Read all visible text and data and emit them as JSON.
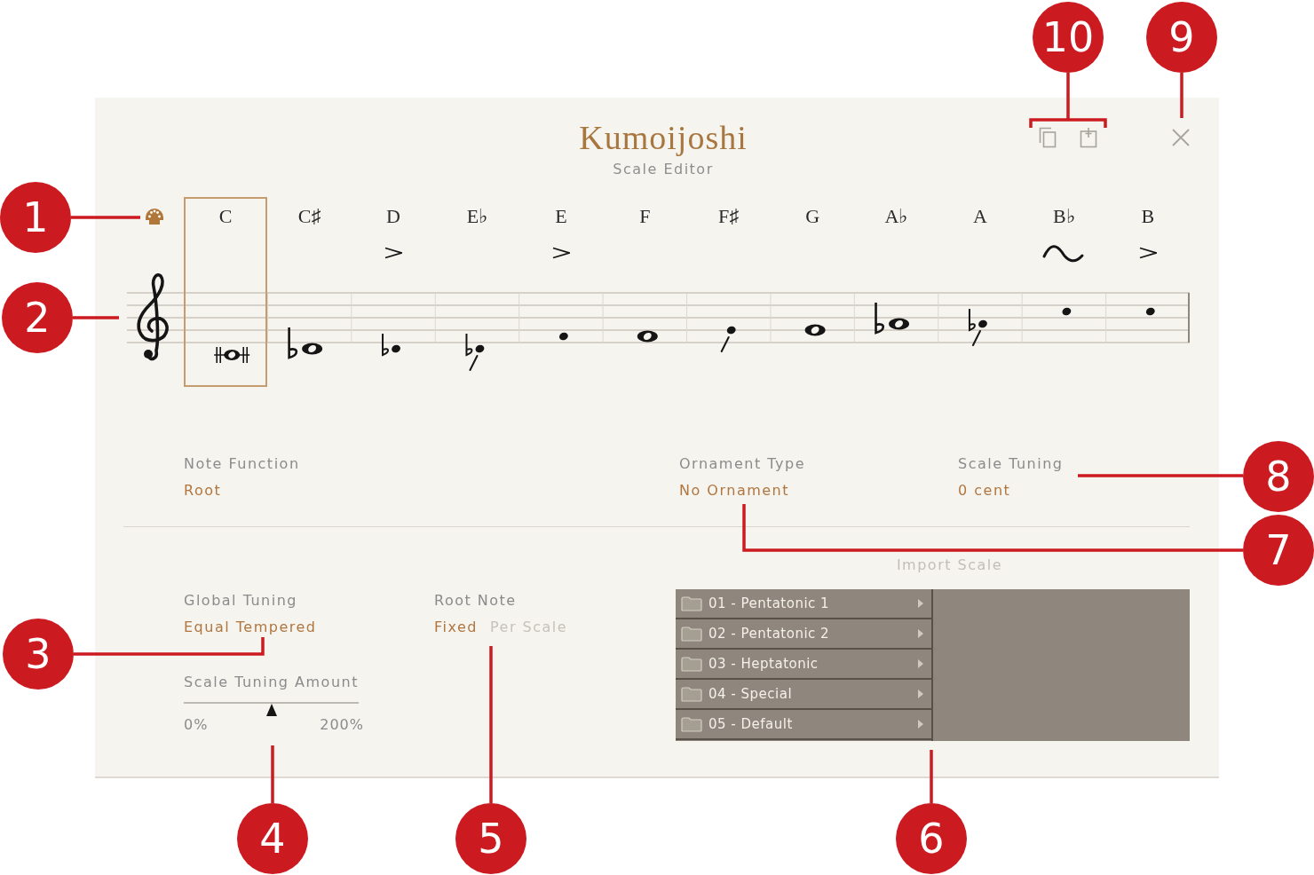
{
  "header": {
    "title": "Kumoijoshi",
    "subtitle": "Scale Editor"
  },
  "notes": [
    {
      "name": "C",
      "selected": true
    },
    {
      "name": "C♯",
      "selected": false
    },
    {
      "name": "D",
      "selected": false,
      "ornament": {
        "kind": "accent"
      }
    },
    {
      "name": "E♭",
      "selected": false
    },
    {
      "name": "E",
      "selected": false,
      "ornament": {
        "kind": "accent"
      }
    },
    {
      "name": "F",
      "selected": false
    },
    {
      "name": "F♯",
      "selected": false
    },
    {
      "name": "G",
      "selected": false
    },
    {
      "name": "A♭",
      "selected": false
    },
    {
      "name": "A",
      "selected": false
    },
    {
      "name": "B♭",
      "selected": false,
      "ornament": {
        "kind": "turn"
      }
    },
    {
      "name": "B",
      "selected": false,
      "ornament": {
        "kind": "accent"
      }
    }
  ],
  "note_function": {
    "label": "Note Function",
    "value": "Root"
  },
  "ornament_type": {
    "label": "Ornament Type",
    "value": "No Ornament"
  },
  "scale_tuning": {
    "label": "Scale Tuning",
    "value": "0 cent"
  },
  "global_tuning": {
    "label": "Global Tuning",
    "value": "Equal Tempered"
  },
  "root_note": {
    "label": "Root Note",
    "options": [
      {
        "label": "Fixed",
        "selected": true
      },
      {
        "label": "Per Scale",
        "selected": false
      }
    ]
  },
  "scale_tuning_amount": {
    "label": "Scale Tuning Amount",
    "level": 0.5,
    "min_label": "0%",
    "max_label": "200%"
  },
  "import_scale": {
    "label": "Import Scale",
    "folders": [
      {
        "name": "01 - Pentatonic 1"
      },
      {
        "name": "02 - Pentatonic 2"
      },
      {
        "name": "03 - Heptatonic"
      },
      {
        "name": "04 - Special"
      },
      {
        "name": "05 - Default"
      }
    ]
  },
  "callouts": [
    {
      "number": "1"
    },
    {
      "number": "2"
    },
    {
      "number": "3"
    },
    {
      "number": "4"
    },
    {
      "number": "5"
    },
    {
      "number": "6"
    },
    {
      "number": "7"
    },
    {
      "number": "8"
    },
    {
      "number": "9"
    },
    {
      "number": "10"
    }
  ]
}
